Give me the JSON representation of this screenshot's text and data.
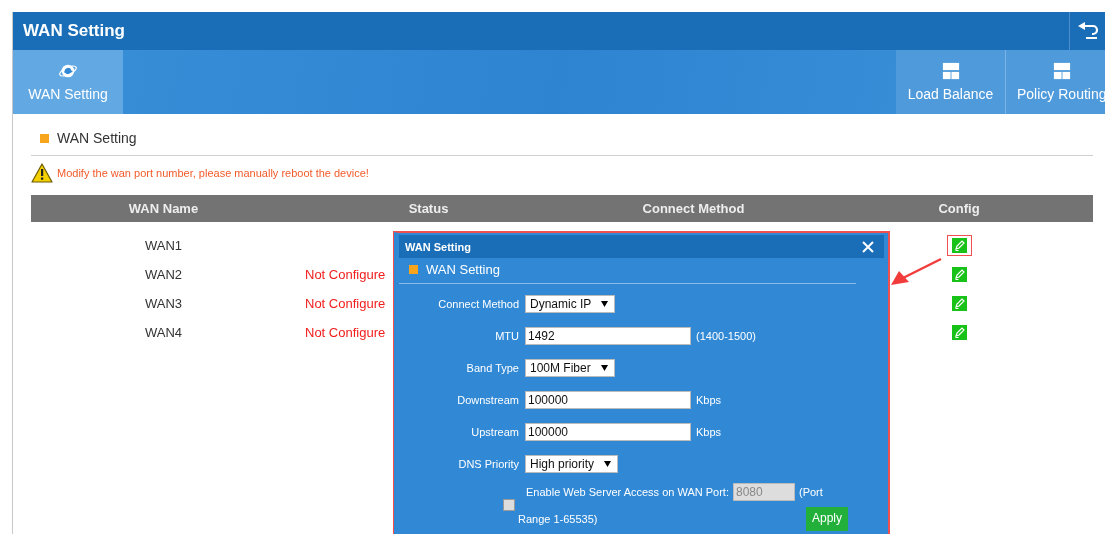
{
  "window": {
    "title": "WAN Setting"
  },
  "tabs": [
    {
      "label": "WAN Setting",
      "selected": true
    },
    {
      "label": "Load Balance",
      "selected": false
    },
    {
      "label": "Policy Routing",
      "selected": false
    }
  ],
  "section": {
    "title": "WAN Setting"
  },
  "warning": "Modify the wan port number, please manually reboot the device!",
  "table": {
    "columns": [
      "WAN Name",
      "Status",
      "Connect Method",
      "Config"
    ],
    "rows": [
      {
        "name": "WAN1",
        "status": "",
        "method": "",
        "highlighted": true
      },
      {
        "name": "WAN2",
        "status": "Not Configure",
        "method": "",
        "highlighted": false
      },
      {
        "name": "WAN3",
        "status": "Not Configure",
        "method": "",
        "highlighted": false
      },
      {
        "name": "WAN4",
        "status": "Not Configure",
        "method": "",
        "highlighted": false
      }
    ]
  },
  "dialog": {
    "title": "WAN Setting",
    "section": "WAN Setting",
    "fields": [
      {
        "kind": "select",
        "label": "Connect Method",
        "value": "Dynamic IP"
      },
      {
        "kind": "text",
        "label": "MTU",
        "value": "1492",
        "note": "(1400-1500)"
      },
      {
        "kind": "select",
        "label": "Band Type",
        "value": "100M Fiber"
      },
      {
        "kind": "text",
        "label": "Downstream",
        "value": "100000",
        "note": "Kbps"
      },
      {
        "kind": "text",
        "label": "Upstream",
        "value": "100000",
        "note": "Kbps"
      },
      {
        "kind": "select",
        "label": "DNS Priority",
        "value": "High priority"
      }
    ],
    "web_access": {
      "checked": false,
      "label": "Enable Web Server Access on WAN Port:",
      "port": "8080",
      "note": "(Port",
      "note_2": "Range 1-65535)"
    },
    "apply": "Apply"
  }
}
